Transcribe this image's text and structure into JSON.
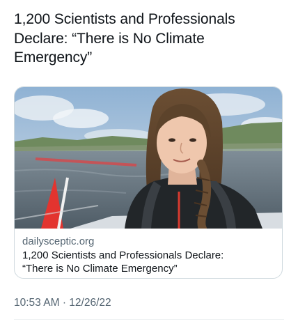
{
  "tweet": {
    "text_line1": "1,200 Scientists and Professionals",
    "text_line2": "Declare: “There is No Climate",
    "text_line3": "Emergency”"
  },
  "link_card": {
    "domain": "dailysceptic.org",
    "title_line1": "1,200 Scientists and Professionals Declare:",
    "title_line2": "“There is No Climate Emergency”",
    "image": "photo-young-woman-on-boat"
  },
  "footer": {
    "time": "10:53 AM",
    "separator": "·",
    "date": "12/26/22"
  },
  "colors": {
    "text": "#0f1419",
    "secondary": "#536471",
    "card_border": "#cfd9de"
  }
}
